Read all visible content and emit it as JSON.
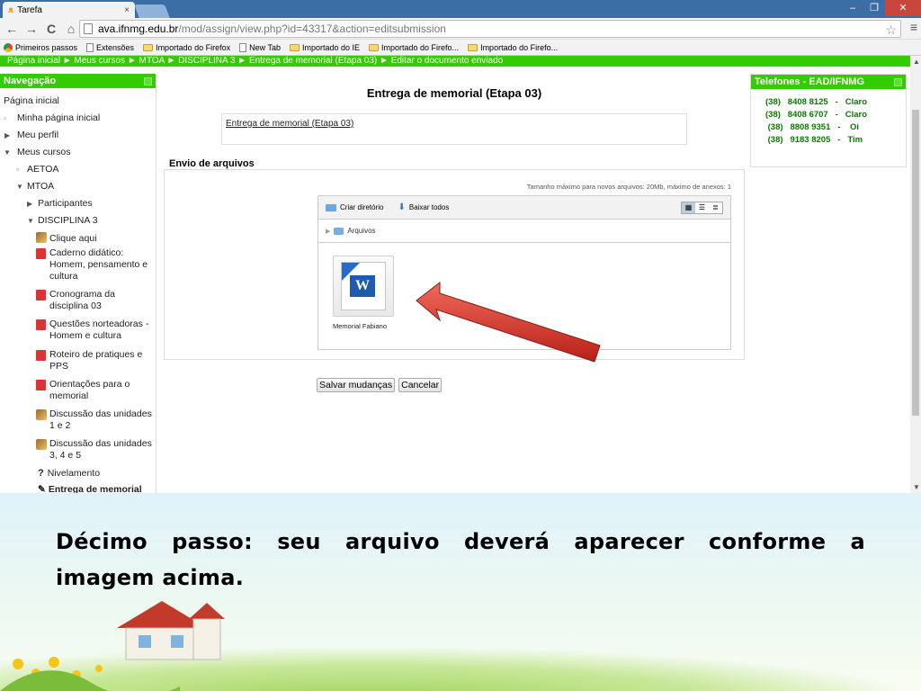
{
  "browser": {
    "tab_title": "Tarefa",
    "tab_close": "×",
    "url_host": "ava.ifnmg.edu.br",
    "url_path": "/mod/assign/view.php?id=43317&action=editsubmission",
    "window_controls": {
      "minimize": "–",
      "restore": "❐",
      "close": "✕"
    },
    "nav": {
      "back": "←",
      "forward": "→",
      "reload": "C",
      "home": "⌂"
    },
    "bookmarks": [
      {
        "label": "Primeiros passos",
        "icon": "chrome-icon"
      },
      {
        "label": "Extensões",
        "icon": "page-icon"
      },
      {
        "label": "Importado do Firefox",
        "icon": "folder-icon"
      },
      {
        "label": "New Tab",
        "icon": "page-icon"
      },
      {
        "label": "Importado do IE",
        "icon": "folder-icon"
      },
      {
        "label": "Importado do Firefo...",
        "icon": "folder-icon"
      },
      {
        "label": "Importado do Firefo...",
        "icon": "folder-icon"
      }
    ]
  },
  "breadcrumb": "Página inicial ► Meus cursos ► MTOA ► DISCIPLINA 3 ► Entrega de memorial (Etapa 03) ► Editar o documento enviado",
  "nav_block": {
    "title": "Navegação",
    "items": {
      "home": "Página inicial",
      "my_home": "Minha página inicial",
      "profile": "Meu perfil",
      "my_courses": "Meus cursos",
      "aetoa": "AETOA",
      "mtoa": "MTOA",
      "participants": "Participantes",
      "discipline": "DISCIPLINA 3",
      "click_here": "Clique aqui",
      "caderno": "Caderno didático: Homem, pensamento e cultura",
      "cronograma": "Cronograma da disciplina 03",
      "questoes": "Questões norteadoras - Homem e cultura",
      "roteiro": "Roteiro de pratiques e PPS",
      "orientacoes": "Orientações para o memorial",
      "discussao12": "Discussão das unidades 1 e 2",
      "discussao345": "Discussão das unidades 3, 4 e 5",
      "nivelamento": "Nivelamento",
      "entrega": "Entrega de memorial"
    }
  },
  "assignment": {
    "title": "Entrega de memorial (Etapa 03)",
    "intro_link": "Entrega de memorial (Etapa 03)",
    "legend": "Envio de arquivos",
    "max_size": "Tamanho máximo para novos arquivos: 20Mb, máximo de anexos: 1",
    "toolbar": {
      "create_dir": "Criar diretório",
      "download_all": "Baixar todos"
    },
    "path_folder": "Arquivos",
    "file_name": "Memorial Fabiano",
    "save_button": "Salvar mudanças",
    "cancel_button": "Cancelar"
  },
  "phones_block": {
    "title": "Telefones - EAD/IFNMG",
    "lines": [
      "(38)   8408 8125   -   Claro",
      "(38)   8408 6707   -   Claro",
      " (38)   8808 9351   -    Oi",
      " (38)   9183 8205   -   Tim"
    ]
  },
  "slide": {
    "caption_line1": "Décimo passo: seu arquivo deverá aparecer conforme a",
    "caption_line2": "imagem acima."
  },
  "colors": {
    "accent_green": "#33cc00",
    "phone_text": "#0a7a00",
    "arrow_red": "#d8342a"
  }
}
